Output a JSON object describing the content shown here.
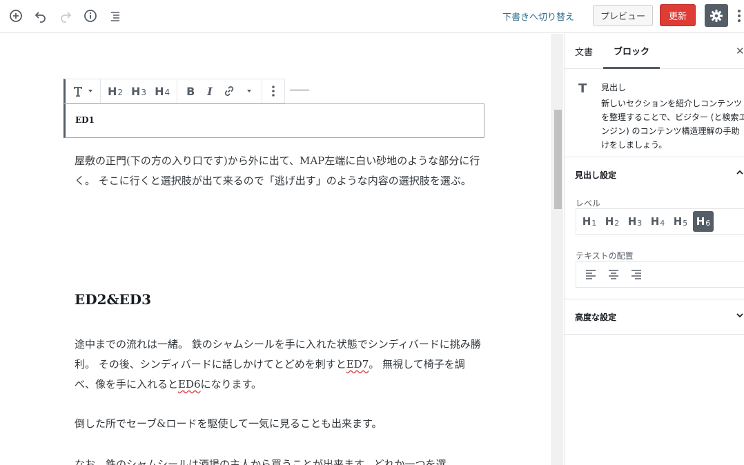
{
  "topbar": {
    "icons": [
      "add-block-icon",
      "undo-icon",
      "redo-icon",
      "info-icon",
      "outline-icon",
      "gear-icon",
      "more-vertical-icon"
    ],
    "switch_to_draft": "下書きへ切り替え",
    "preview": "プレビュー",
    "update": "更新"
  },
  "block_toolbar": {
    "icons": [
      "heading-transform-icon",
      "dropdown-arrow-icon",
      "bold-icon",
      "italic-icon",
      "link-icon",
      "more-rich-text-arrow-icon",
      "more-options-icon"
    ],
    "h_letter": "H",
    "h2_level": "2",
    "h3_level": "3",
    "h4_level": "4",
    "bold": "B",
    "italic": "I"
  },
  "editor": {
    "heading_ed1": "ED1",
    "para1": "屋敷の正門(下の方の入り口です)から外に出て、MAP左端に白い砂地のような部分に行く。 そこに行くと選択肢が出て来るので「逃げ出す」のような内容の選択肢を選ぶ。",
    "heading_ed2": "ED2&ED3",
    "para2_a": "途中までの流れは一緒。 鉄のシャムシールを手に入れた状態でシンディバードに挑み勝利。 その後、シンディバードに話しかけてとどめを刺すと",
    "para2_ed7": "ED7",
    "para2_b": "。 無視して椅子を調べ、像を手に入れると",
    "para2_ed6": "ED6",
    "para2_c": "になります。",
    "para3": "倒した所でセーブ&ロードを駆使して一気に見ることも出来ます。",
    "para4": "なお、鉄のシャムシールは酒場の主人から買うことが出来ます。どれか一つを選"
  },
  "sidebar": {
    "tab_document": "文書",
    "tab_block": "ブロック",
    "close": "✕",
    "block_icon": "T",
    "block_title": "見出し",
    "block_desc": "新しいセクションを紹介しコンテンツを整理することで、ビジター (と検索エンジン) のコンテンツ構造理解の手助けをしましょう。",
    "heading_settings": "見出し設定",
    "level_label": "レベル",
    "levels": [
      {
        "letter": "H",
        "num": "1"
      },
      {
        "letter": "H",
        "num": "2"
      },
      {
        "letter": "H",
        "num": "3"
      },
      {
        "letter": "H",
        "num": "4"
      },
      {
        "letter": "H",
        "num": "5"
      },
      {
        "letter": "H",
        "num": "6"
      }
    ],
    "selected_level": 6,
    "text_align_label": "テキストの配置",
    "align_icons": [
      "align-left-icon",
      "align-center-icon",
      "align-right-icon"
    ],
    "advanced": "高度な設定"
  }
}
